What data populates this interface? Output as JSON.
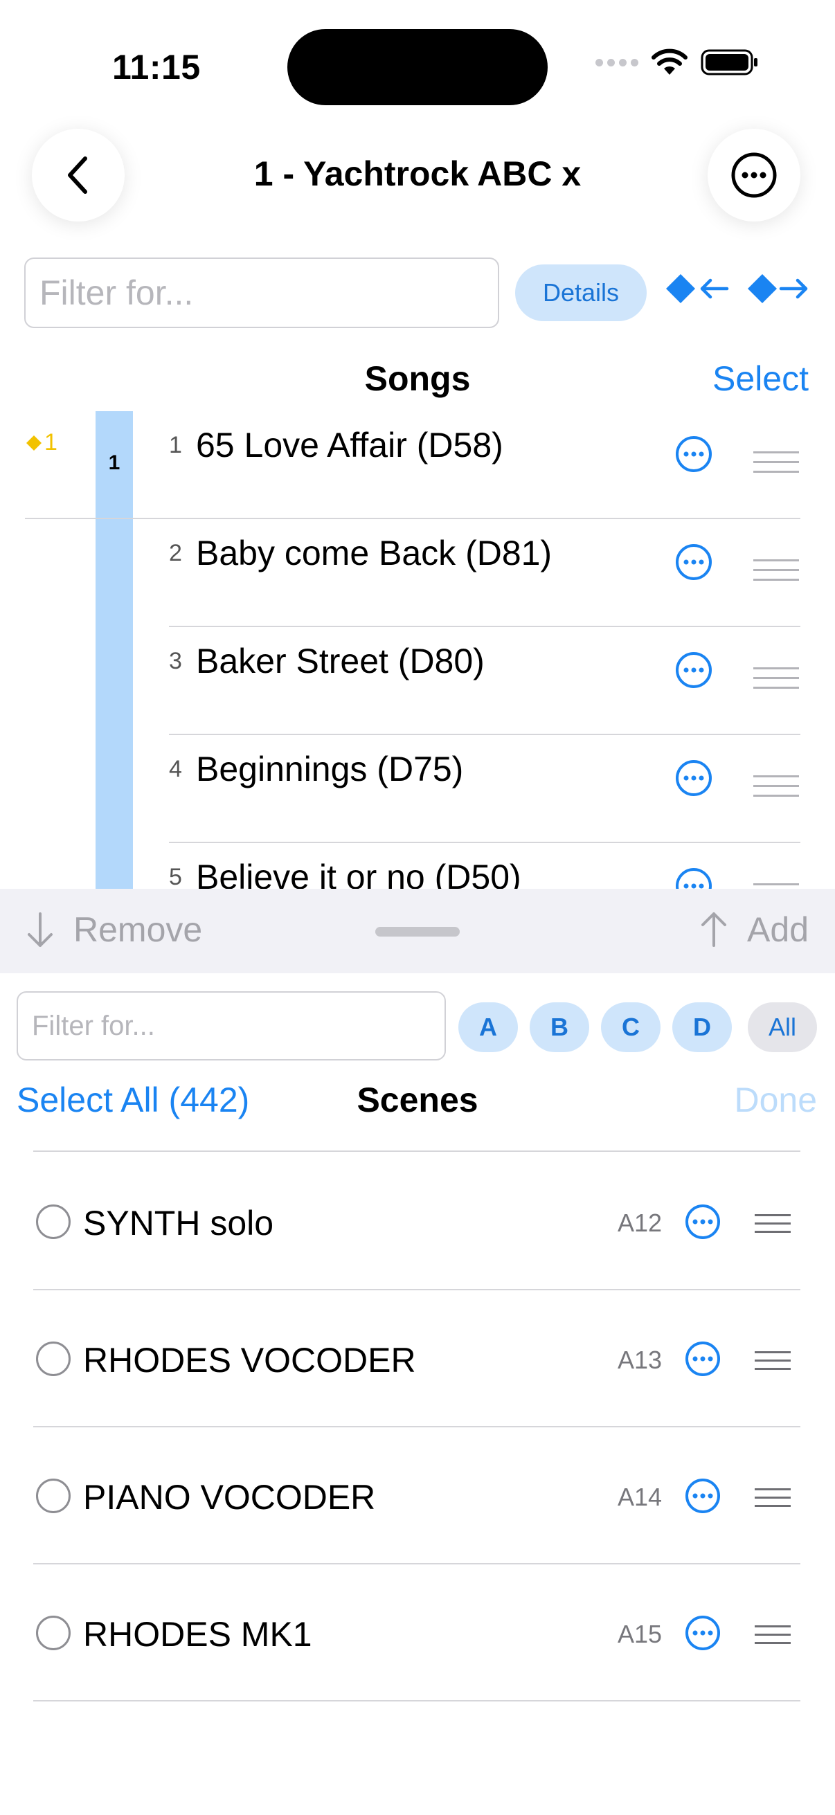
{
  "status_bar": {
    "time": "11:15"
  },
  "nav": {
    "title": "1 - Yachtrock ABC x"
  },
  "top_toolbar": {
    "filter_placeholder": "Filter for...",
    "details_label": "Details"
  },
  "songs": {
    "title": "Songs",
    "select_label": "Select",
    "current_marker": "1",
    "group_number": "1",
    "items": [
      {
        "num": "1",
        "name": "65 Love Affair (D58)"
      },
      {
        "num": "2",
        "name": "Baby come Back (D81)"
      },
      {
        "num": "3",
        "name": "Baker Street (D80)"
      },
      {
        "num": "4",
        "name": "Beginnings (D75)"
      },
      {
        "num": "5",
        "name": "Believe it or no (D50)"
      }
    ]
  },
  "transfer_bar": {
    "remove_label": "Remove",
    "add_label": "Add"
  },
  "scenes": {
    "filter_placeholder": "Filter for...",
    "banks": [
      "A",
      "B",
      "C",
      "D",
      "All"
    ],
    "select_all_label": "Select All (442)",
    "title": "Scenes",
    "done_label": "Done",
    "items": [
      {
        "name": "SYNTH solo",
        "code": "A12"
      },
      {
        "name": "RHODES VOCODER",
        "code": "A13"
      },
      {
        "name": "PIANO VOCODER",
        "code": "A14"
      },
      {
        "name": "RHODES MK1",
        "code": "A15"
      }
    ]
  },
  "colors": {
    "accent": "#1a84f2",
    "pill_bg": "#cfe5fb",
    "song_bar": "#b3d8fb",
    "marker": "#f2c200"
  }
}
